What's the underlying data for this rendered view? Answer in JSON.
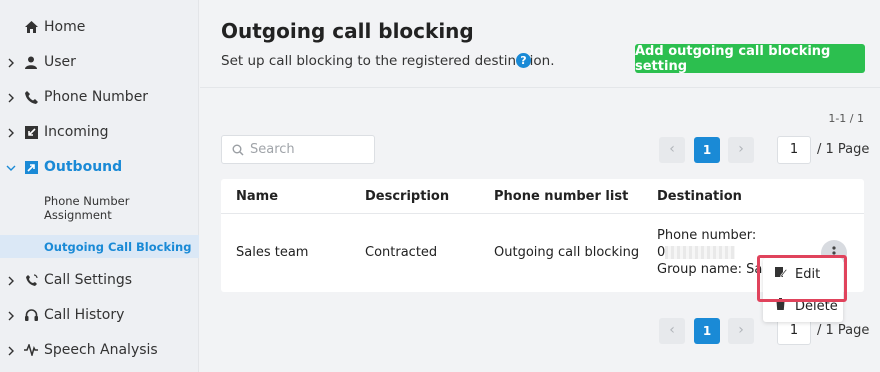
{
  "sidebar": {
    "items": [
      {
        "label": "Home",
        "icon": "home-icon"
      },
      {
        "label": "User",
        "icon": "user-icon"
      },
      {
        "label": "Phone Number",
        "icon": "phone-icon"
      },
      {
        "label": "Incoming",
        "icon": "incoming-icon"
      },
      {
        "label": "Outbound",
        "icon": "outbound-icon"
      },
      {
        "label": "Call Settings",
        "icon": "call-settings-icon"
      },
      {
        "label": "Call History",
        "icon": "headset-icon"
      },
      {
        "label": "Speech Analysis",
        "icon": "waveform-icon"
      }
    ],
    "sub_items": [
      {
        "label": "Phone Number Assignment"
      },
      {
        "label": "Outgoing Call Blocking"
      }
    ]
  },
  "header": {
    "title": "Outgoing call blocking",
    "subtitle": "Set up call blocking to the registered destination.",
    "help": "?",
    "add_button": "Add outgoing call blocking setting"
  },
  "list": {
    "range": "1-1 / 1",
    "search_placeholder": "Search",
    "page_current": "1",
    "page_input": "1",
    "page_total": "/ 1 Page",
    "prev": "‹",
    "next": "›"
  },
  "table": {
    "columns": [
      "Name",
      "Description",
      "Phone number list",
      "Destination"
    ],
    "rows": [
      {
        "name": "Sales team",
        "description": "Contracted",
        "phone_list": "Outgoing call blocking",
        "dest_phone_label": "Phone number:",
        "dest_phone_prefix": "0",
        "dest_group": "Group name: Sales"
      }
    ]
  },
  "row_menu": {
    "edit": "Edit",
    "delete": "Delete"
  },
  "colors": {
    "accent": "#1a8ad6",
    "add_button": "#2cbf4f",
    "highlight": "#e0435c"
  }
}
